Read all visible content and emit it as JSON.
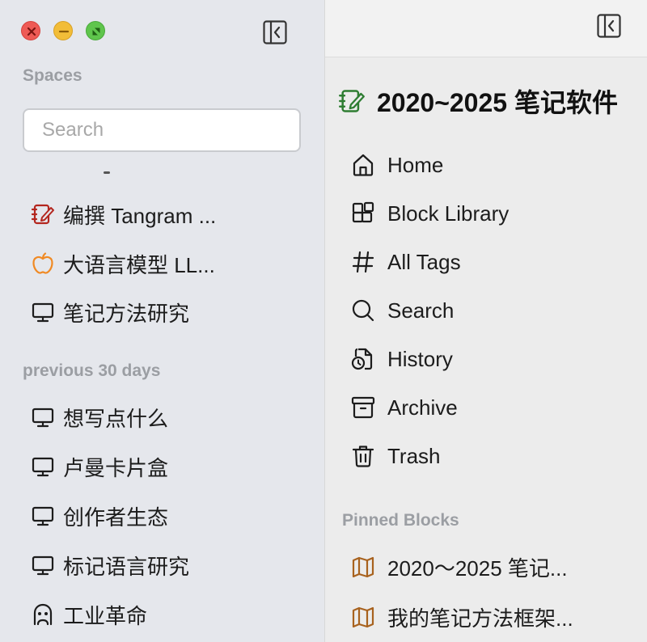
{
  "window": {
    "controls": [
      "close",
      "minimize",
      "maximize"
    ]
  },
  "sidebar": {
    "spaces_label": "Spaces",
    "search": {
      "placeholder": "Search",
      "value": ""
    },
    "recent_items": [
      {
        "label": "编撰 Tangram ...",
        "icon": "notebook-icon",
        "color": "#b3261e"
      },
      {
        "label": "大语言模型 LL...",
        "icon": "apple-icon",
        "color": "#f08a24"
      },
      {
        "label": "笔记方法研究",
        "icon": "monitor-icon",
        "color": "#1c1c1c"
      }
    ],
    "previous_label": "previous 30 days",
    "previous_items": [
      {
        "label": "想写点什么",
        "icon": "monitor-icon"
      },
      {
        "label": "卢曼卡片盒",
        "icon": "monitor-icon"
      },
      {
        "label": "创作者生态",
        "icon": "monitor-icon"
      },
      {
        "label": "标记语言研究",
        "icon": "monitor-icon"
      },
      {
        "label": "工业革命",
        "icon": "face-icon"
      }
    ]
  },
  "main": {
    "title": "2020~2025 笔记软件",
    "title_icon_color": "#2e7d32",
    "nav": [
      {
        "label": "Home",
        "icon": "home-icon"
      },
      {
        "label": "Block Library",
        "icon": "blocks-icon"
      },
      {
        "label": "All Tags",
        "icon": "hash-icon"
      },
      {
        "label": "Search",
        "icon": "search-icon"
      },
      {
        "label": "History",
        "icon": "history-icon"
      },
      {
        "label": "Archive",
        "icon": "archive-icon"
      },
      {
        "label": "Trash",
        "icon": "trash-icon"
      }
    ],
    "pinned_label": "Pinned Blocks",
    "pinned": [
      {
        "label": "2020～2025 笔记...",
        "icon": "map-icon",
        "color": "#a8621e"
      },
      {
        "label": "我的笔记方法框架...",
        "icon": "map-icon",
        "color": "#a8621e"
      }
    ]
  }
}
